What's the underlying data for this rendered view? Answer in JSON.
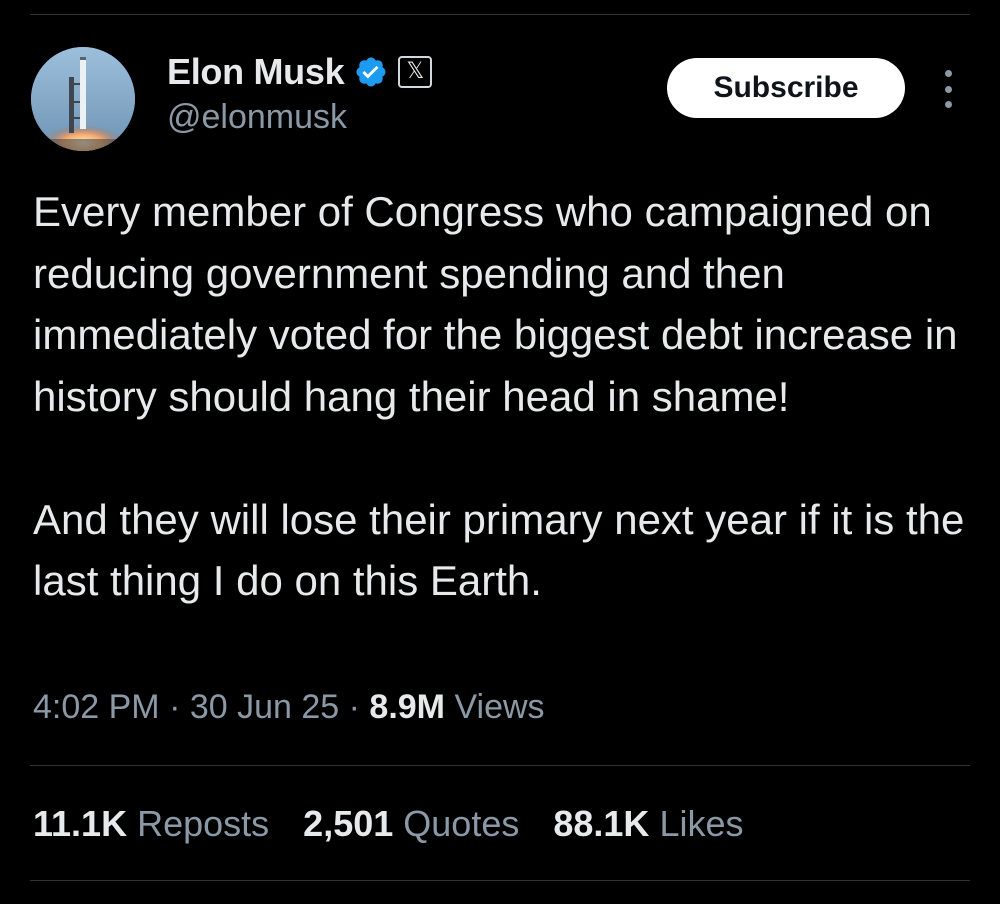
{
  "author": {
    "display_name": "Elon Musk",
    "handle": "@elonmusk",
    "verified_icon": "verified-badge-icon",
    "affiliate_badge": "x-logo-icon",
    "affiliate_glyph": "𝕏"
  },
  "actions": {
    "subscribe_label": "Subscribe",
    "more_icon": "more-vertical-icon"
  },
  "tweet": {
    "paragraphs": [
      "Every member of Congress who campaigned on reducing government spending and then immediately voted for the biggest debt increase in history should hang their head in shame!",
      "And they will lose their primary next year if it is the last thing I do on this Earth."
    ]
  },
  "meta": {
    "time": "4:02 PM",
    "separator": " · ",
    "date": "30 Jun 25",
    "views_count": "8.9M",
    "views_label": "Views"
  },
  "stats": {
    "reposts_count": "11.1K",
    "reposts_label": "Reposts",
    "quotes_count": "2,501",
    "quotes_label": "Quotes",
    "likes_count": "88.1K",
    "likes_label": "Likes"
  },
  "colors": {
    "background": "#000000",
    "primary_text": "#e7e9ea",
    "secondary_text": "#8b98a5",
    "divider": "#2f3336",
    "verified_blue": "#1d9bf0",
    "subscribe_bg": "#ffffff"
  }
}
